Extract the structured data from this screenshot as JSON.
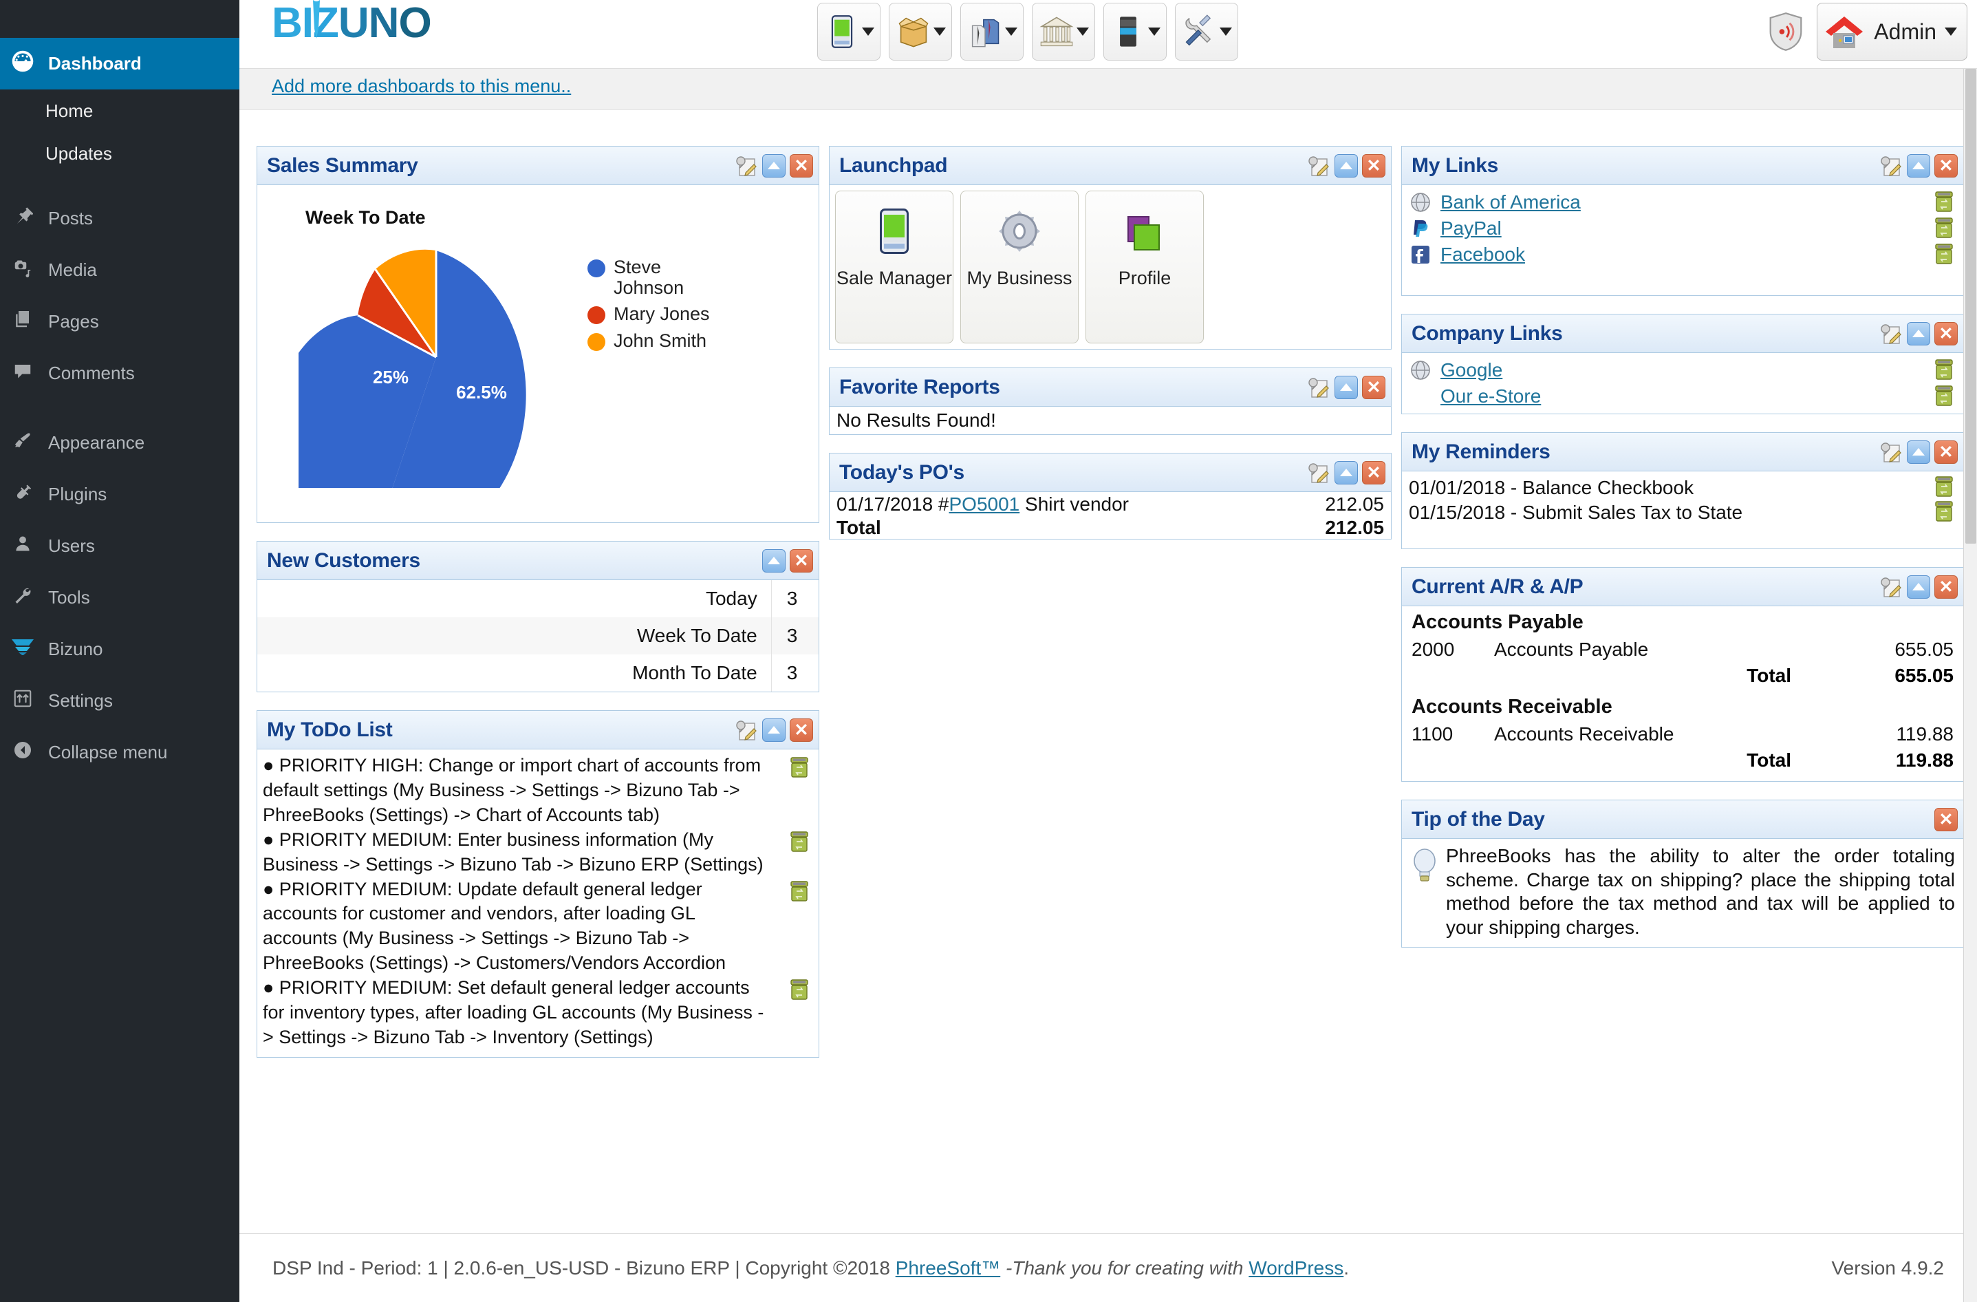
{
  "wp_sidebar": {
    "items": [
      {
        "label": "Dashboard",
        "icon": "dashboard-icon",
        "current": true
      },
      {
        "label": "Home",
        "icon": "",
        "sub": true
      },
      {
        "label": "Updates",
        "icon": "",
        "sub": true
      },
      {
        "label": "Posts",
        "icon": "pin-icon"
      },
      {
        "label": "Media",
        "icon": "media-icon"
      },
      {
        "label": "Pages",
        "icon": "pages-icon"
      },
      {
        "label": "Comments",
        "icon": "comment-icon"
      },
      {
        "label": "Appearance",
        "icon": "paintbrush-icon"
      },
      {
        "label": "Plugins",
        "icon": "plug-icon"
      },
      {
        "label": "Users",
        "icon": "user-icon"
      },
      {
        "label": "Tools",
        "icon": "wrench-icon"
      },
      {
        "label": "Bizuno",
        "icon": "bizuno-icon"
      },
      {
        "label": "Settings",
        "icon": "settings-icon"
      },
      {
        "label": "Collapse menu",
        "icon": "collapse-icon"
      }
    ]
  },
  "header": {
    "logo": "BIZUNO",
    "logo_letters": [
      "B",
      "I",
      "Z",
      "U",
      "N",
      "O"
    ],
    "toolbar_buttons": [
      {
        "name": "pda-icon",
        "title": "Sale Manager"
      },
      {
        "name": "box-icon",
        "title": "Inventory"
      },
      {
        "name": "shirt-icon",
        "title": "Contacts"
      },
      {
        "name": "bank-icon",
        "title": "Banking"
      },
      {
        "name": "battery-icon",
        "title": "Reports"
      },
      {
        "name": "tools-icon",
        "title": "Tools"
      }
    ],
    "shield_icon": "shield-icon",
    "admin_label": "Admin"
  },
  "dashboards_link": "Add more dashboards to this menu..",
  "panels": {
    "sales_summary": {
      "title": "Sales Summary",
      "chart_title": "Week To Date"
    },
    "new_customers": {
      "title": "New Customers",
      "rows": [
        {
          "label": "Today",
          "value": "3"
        },
        {
          "label": "Week To Date",
          "value": "3"
        },
        {
          "label": "Month To Date",
          "value": "3"
        }
      ]
    },
    "todo": {
      "title": "My ToDo List",
      "items": [
        "● PRIORITY HIGH: Change or import chart of accounts from default settings (My Business -> Settings -> Bizuno Tab -> PhreeBooks (Settings) -> Chart of Accounts tab)",
        "● PRIORITY MEDIUM: Enter business information (My Business -> Settings -> Bizuno Tab -> Bizuno ERP (Settings)",
        "● PRIORITY MEDIUM: Update default general ledger accounts for customer and vendors, after loading GL accounts (My Business -> Settings -> Bizuno Tab -> PhreeBooks (Settings) -> Customers/Vendors Accordion",
        "● PRIORITY MEDIUM: Set default general ledger accounts for inventory types, after loading GL accounts (My Business -> Settings -> Bizuno Tab -> Inventory (Settings)"
      ]
    },
    "launchpad": {
      "title": "Launchpad",
      "tiles": [
        {
          "label": "Sale Manager",
          "icon": "pda-icon"
        },
        {
          "label": "My Business",
          "icon": "gear-icon"
        },
        {
          "label": "Profile",
          "icon": "books-icon"
        }
      ]
    },
    "favorite_reports": {
      "title": "Favorite Reports",
      "empty_text": "No Results Found!"
    },
    "todays_pos": {
      "title": "Today's PO's",
      "rows": [
        {
          "date": "01/17/2018",
          "hash": "#",
          "po": "PO5001",
          "vendor": "Shirt vendor",
          "amount": "212.05"
        }
      ],
      "total_label": "Total",
      "total_amount": "212.05"
    },
    "my_links": {
      "title": "My Links",
      "links": [
        {
          "label": "Bank of America",
          "icon": "globe-icon"
        },
        {
          "label": "PayPal",
          "icon": "paypal-icon"
        },
        {
          "label": "Facebook",
          "icon": "facebook-icon"
        }
      ]
    },
    "company_links": {
      "title": "Company Links",
      "links": [
        {
          "label": "Google",
          "icon": "globe-icon"
        },
        {
          "label": "Our e-Store",
          "icon": "none"
        }
      ]
    },
    "my_reminders": {
      "title": "My Reminders",
      "items": [
        "01/01/2018 - Balance Checkbook",
        "01/15/2018 - Submit Sales Tax to State"
      ]
    },
    "arap": {
      "title": "Current A/R & A/P",
      "sections": [
        {
          "heading": "Accounts Payable",
          "rows": [
            {
              "id": "2000",
              "name": "Accounts Payable",
              "amount": "655.05"
            }
          ],
          "total_label": "Total",
          "total_amount": "655.05"
        },
        {
          "heading": "Accounts Receivable",
          "rows": [
            {
              "id": "1100",
              "name": "Accounts Receivable",
              "amount": "119.88"
            }
          ],
          "total_label": "Total",
          "total_amount": "119.88"
        }
      ]
    },
    "tip": {
      "title": "Tip of the Day",
      "text": "PhreeBooks has the ability to alter the order totaling scheme. Charge tax on shipping? place the shipping total method before the tax method and tax will be applied to your shipping charges."
    }
  },
  "footer": {
    "left_pre": "DSP Ind - Period: 1 | 2.0.6-en_US-USD - Bizuno ERP | Copyright ©2018 ",
    "phreesoft": "PhreeSoft™",
    "thanks": " -Thank you for creating with ",
    "wordpress": "WordPress",
    "period": ".",
    "version": "Version 4.9.2"
  },
  "chart_data": {
    "type": "pie",
    "title": "Week To Date",
    "labels": [
      "Steve Johnson",
      "Mary Jones",
      "John Smith"
    ],
    "values": [
      62.5,
      25,
      12.5
    ],
    "value_labels": [
      "62.5%",
      "25%",
      ""
    ],
    "colors": [
      "#3366cc",
      "#dc3912",
      "#ff9900"
    ],
    "legend_position": "right",
    "grid": false
  }
}
